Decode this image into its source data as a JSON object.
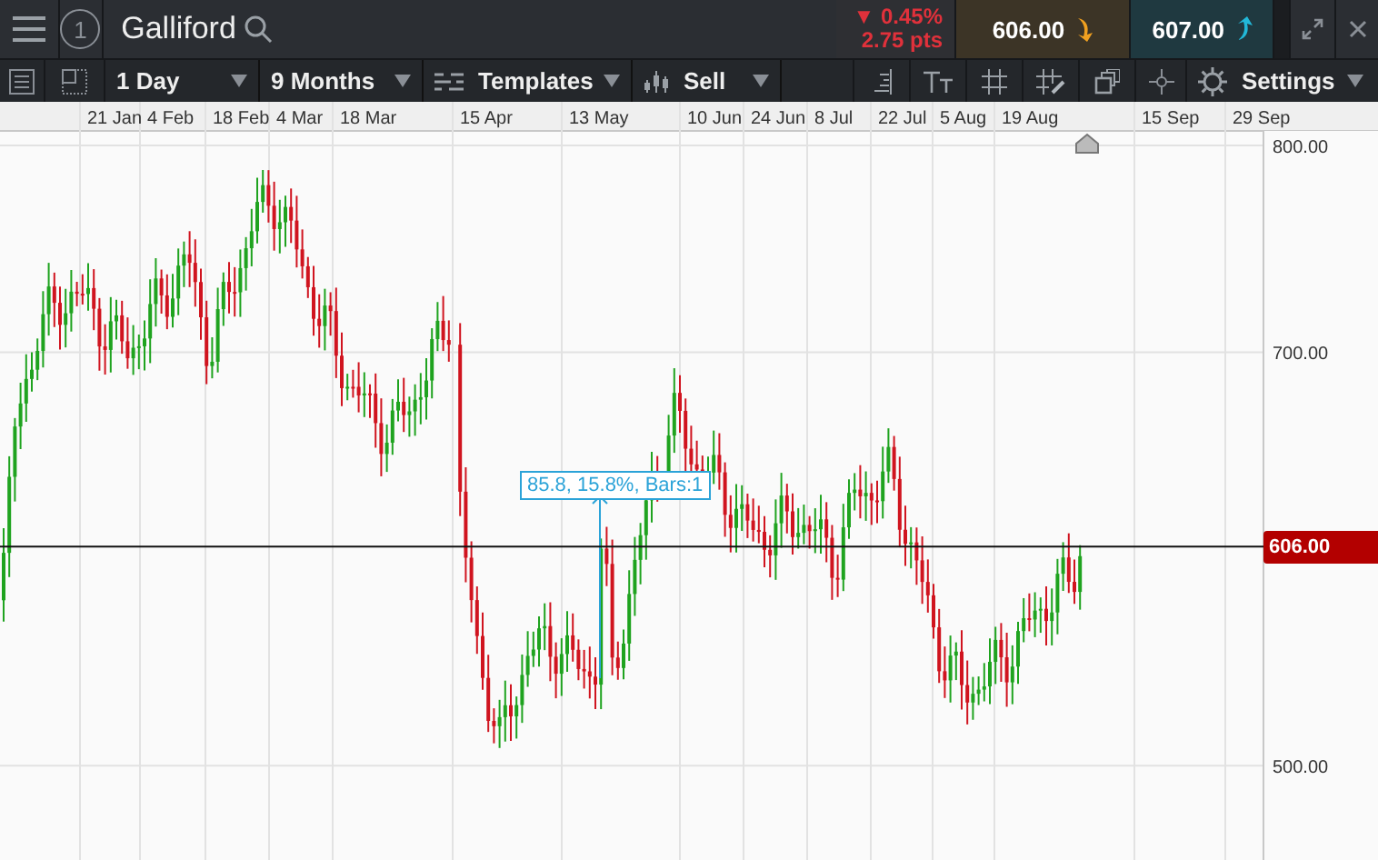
{
  "top_bar": {
    "step": "1",
    "instrument": "Galliford",
    "change": {
      "rising": false,
      "percent": "▼ 0.45%",
      "points": "2.75 pts"
    },
    "sell_price": {
      "value": "606.00",
      "rising": false
    },
    "buy_price": {
      "value": "607.00",
      "rising": true
    }
  },
  "toolbar": {
    "interval": "1 Day",
    "range": "9 Months",
    "templates": "Templates",
    "order_type": "Sell",
    "settings": "Settings"
  },
  "chart": {
    "date_labels": [
      "21 Jan",
      "4 Feb",
      "18 Feb",
      "4 Mar",
      "18 Mar",
      "15 Apr",
      "13 May",
      "10 Jun",
      "24 Jun",
      "8 Jul",
      "22 Jul",
      "5 Aug",
      "19 Aug",
      "15 Sep",
      "29 Sep"
    ],
    "price_labels": [
      "800.00",
      "700.00",
      "500.00"
    ],
    "current_price": "606.00",
    "measurement": "85.8, 15.8%, Bars:1"
  }
}
